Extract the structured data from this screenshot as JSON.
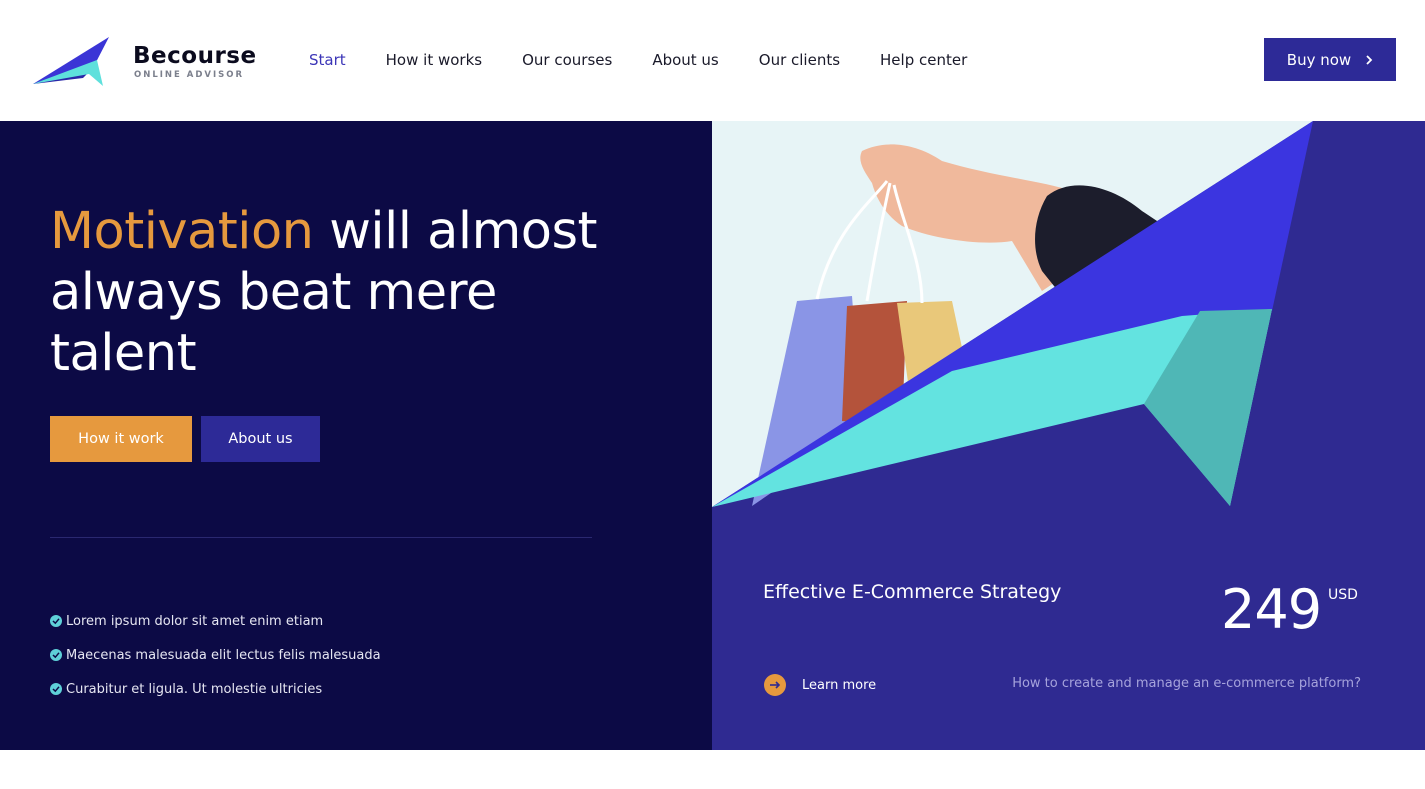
{
  "brand": {
    "name": "Becourse",
    "tagline": "ONLINE ADVISOR"
  },
  "nav": {
    "items": [
      {
        "label": "Start",
        "active": true
      },
      {
        "label": "How it works",
        "active": false
      },
      {
        "label": "Our courses",
        "active": false
      },
      {
        "label": "About us",
        "active": false
      },
      {
        "label": "Our clients",
        "active": false
      },
      {
        "label": "Help center",
        "active": false
      }
    ],
    "buy_label": "Buy now"
  },
  "hero": {
    "headline_accent": "Motivation",
    "headline_rest": " will almost always beat mere talent",
    "primary_button": "How it work",
    "secondary_button": "About us",
    "features": [
      "Lorem ipsum dolor sit amet enim etiam",
      "Maecenas malesuada elit lectus felis malesuada",
      "Curabitur et ligula. Ut molestie ultricies"
    ]
  },
  "course": {
    "title": "Effective E-Commerce Strategy",
    "price": "249",
    "currency": "USD",
    "learn_more": "Learn more",
    "subtitle": "How to create and manage an e-commerce platform?"
  },
  "colors": {
    "accent_orange": "#e6993e",
    "navy": "#0c0a45",
    "indigo": "#2f2a91",
    "button_indigo": "#2d2a97",
    "cyan": "#63e3e0",
    "blue": "#3b35e0",
    "nav_active": "#3b35b7"
  },
  "icons": {
    "logo": "paper-plane-logo-icon",
    "buy_chevron": "chevron-right-icon",
    "feature_check": "check-circle-icon",
    "learn_more": "arrow-right-circle-icon"
  }
}
